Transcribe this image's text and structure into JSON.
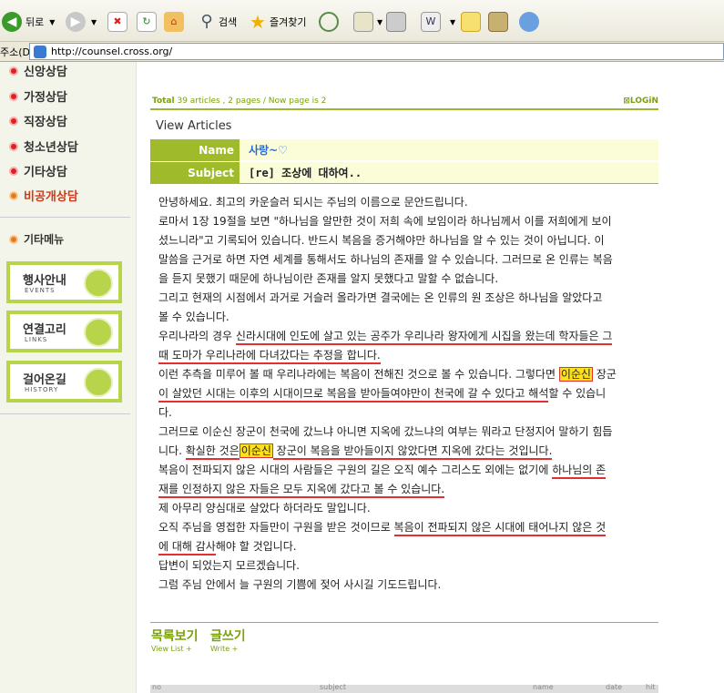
{
  "browser": {
    "back_label": "뒤로",
    "search_label": "검색",
    "favorites_label": "즐겨찾기",
    "address_label": "주소(D)",
    "url": "http://counsel.cross.org/"
  },
  "sidebar": {
    "items": [
      {
        "label": "신앙상담",
        "color": "#e02020"
      },
      {
        "label": "가정상담",
        "color": "#e02020"
      },
      {
        "label": "직장상담",
        "color": "#e02020"
      },
      {
        "label": "청소년상담",
        "color": "#e02020"
      },
      {
        "label": "기타상담",
        "color": "#e02020"
      },
      {
        "label": "비공개상담",
        "color": "#e87a1a"
      }
    ],
    "other_menu_label": "기타메뉴",
    "menu_buttons": [
      {
        "label": "행사안내",
        "sub": "EVENTS"
      },
      {
        "label": "연결고리",
        "sub": "LINKS"
      },
      {
        "label": "걸어온길",
        "sub": "HISTORY"
      }
    ]
  },
  "board": {
    "total_label": "Total",
    "articles_text": "39 articles , 2 pages / Now page is",
    "now_page": "2",
    "login_label": "LOGiN",
    "view_articles": "View Articles",
    "name_label": "Name",
    "name_value": "사랑~♡",
    "subject_label": "Subject",
    "subject_value": "[re] 조상에 대하여..",
    "list_label": "목록보기",
    "list_sub": "View List +",
    "write_label": "글쓰기",
    "write_sub": "Write +",
    "table_headers": [
      "no",
      "subject",
      "name",
      "date",
      "hit"
    ]
  },
  "article": {
    "p1": "안녕하세요. 최고의 카운슬러 되시는 주님의 이름으로 문안드립니다.",
    "p2a": "로마서 1장 19절을 보면 \"하나님을 알만한 것이 저희 속에 보임이라 하나님께서 이를 저희에게 보이",
    "p2b": "셨느니라\"고 기록되어 있습니다. 반드시 복음을 증거해야만 하나님을 알 수 있는 것이 아닙니다. 이",
    "p2c": "말씀을 근거로 하면 자연 세계를 통해서도 하나님의 존재를 알 수 있습니다. 그러므로 온 인류는 복음",
    "p2d": "을 듣지 못했기 때문에 하나님이란 존재를 알지 못했다고 말할 수 없습니다.",
    "p3a": "그리고 현재의 시점에서 과거로 거슬러 올라가면 결국에는 온 인류의 원 조상은 하나님을 알았다고",
    "p3b": "볼 수 있습니다.",
    "p4a_pre": "우리나라의 경우 ",
    "p4a_ul": "신라시대에 인도에 살고 있는 공주가 우리나라 왕자에게 시집을 왔는데 학자들은 그",
    "p4b_ul": "때 도마가 우리나라에 다녀갔다는 추정을 합니다.",
    "p5a_pre": "이런 추측을 미루어 볼 때 우리나라에는 복음이 전해진 것으로 볼 수 있습니다. 그렇다면 ",
    "p5a_hl": "이순신",
    "p5a_post": " 장군",
    "p5b_ul": "이 살았던 시대는 이후의 시대이므로 복음을 받아들여야만이 천국에 갈 수 있다고 해석",
    "p5b_post": "할 수 있습니",
    "p5c": "다.",
    "p6a": "그러므로 이순신 장군이 천국에 갔느냐 아니면 지옥에 갔느냐의 여부는 뭐라고 단정지어 말하기 힘듭",
    "p6b_pre": "니다. ",
    "p6b_ul1": "확실한 것은",
    "p6b_hl": "이순신",
    "p6b_ul2": " 장군이 복음을 받아들이지 않았다면 지옥에 갔다는 것입니다.",
    "p7a_pre": "복음이 전파되지 않은 시대의 사람들은 구원의 길은 오직 예수 그리스도 외에는 없기에 ",
    "p7a_ul": "하나님의 존",
    "p7b_ul": "재를 인정하지 않은 자들은 모두 지옥에 갔다고 볼 수 있습니다.",
    "p8": "제 아무리 양심대로 살았다 하더라도 말입니다.",
    "p9a_pre": "오직 주님을 영접한 자들만이 구원을 받은 것이므로 ",
    "p9a_ul": "복음이 전파되지 않은 시대에 태어나지 않은 것",
    "p9b_ul": "에 대해 감사",
    "p9b_post": "해야 할 것입니다.",
    "p10": "답변이 되었는지 모르겠습니다.",
    "p11": "그럼 주님 안에서 늘 구원의 기쁨에 젖어 사시길 기도드립니다."
  }
}
